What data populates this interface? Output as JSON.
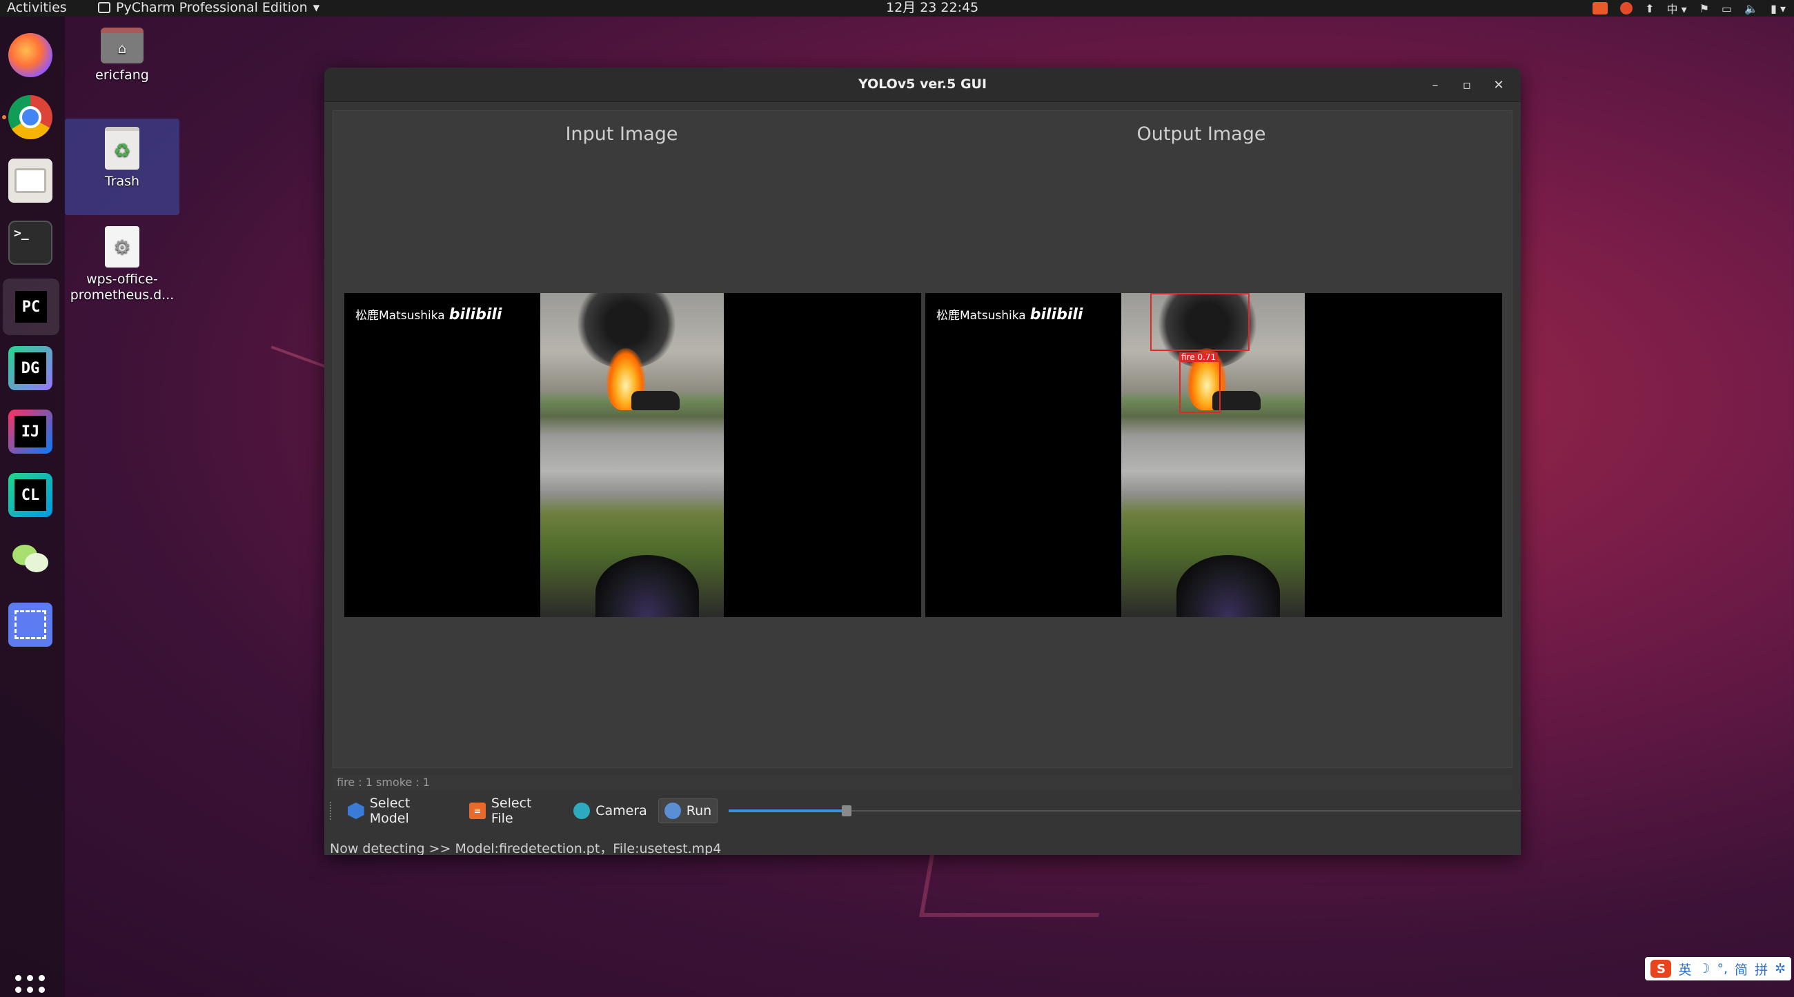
{
  "topbar": {
    "activities": "Activities",
    "app_menu": "PyCharm Professional Edition",
    "clock": "12月 23  22:45",
    "input_method": "中"
  },
  "dock": {
    "items": [
      "firefox",
      "chrome",
      "files",
      "terminal",
      "pycharm",
      "datagrip",
      "intellij",
      "clion",
      "wechat",
      "screenshot"
    ],
    "labels": {
      "terminal": ">_",
      "pycharm": "PC",
      "datagrip": "DG",
      "intellij": "IJ",
      "clion": "CL"
    }
  },
  "desktop": {
    "home_label": "ericfang",
    "trash_label": "Trash",
    "file_label_1": "wps-office-",
    "file_label_2": "prometheus.d..."
  },
  "window": {
    "title": "YOLOv5 ver.5 GUI",
    "input_label": "Input Image",
    "output_label": "Output Image",
    "watermark": "松鹿Matsushika",
    "watermark_logo": "bilibili",
    "detection_label": "fire  0.71",
    "result_counts": "fire : 1  smoke : 1",
    "toolbar": {
      "select_model": "Select Model",
      "select_file": "Select File",
      "camera": "Camera",
      "run": "Run"
    },
    "slider_value": 0.147,
    "status": "Now detecting >> Model:firedetection.pt，File:usetest.mp4"
  },
  "ime": {
    "mode": "英",
    "items": [
      "☽",
      "°,",
      "简",
      "拼",
      "✲"
    ]
  },
  "colors": {
    "accent": "#3d8fe0",
    "detection_box": "#e02828",
    "window_bg": "#353535"
  }
}
